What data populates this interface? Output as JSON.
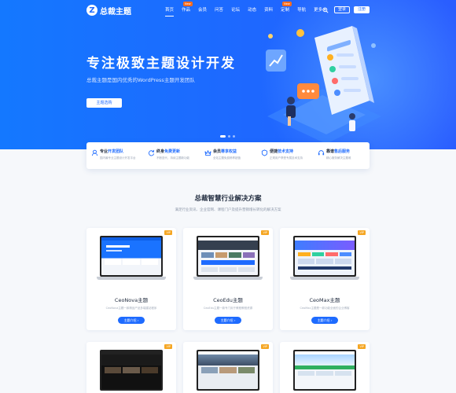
{
  "nav": {
    "logo_text": "总裁主题",
    "logo_mark": "Z",
    "menu": [
      {
        "label": "首页",
        "badge": "",
        "active": true
      },
      {
        "label": "作品",
        "badge": "New",
        "active": false
      },
      {
        "label": "会员",
        "badge": "",
        "active": false
      },
      {
        "label": "问答",
        "badge": "",
        "active": false
      },
      {
        "label": "论坛",
        "badge": "",
        "active": false
      },
      {
        "label": "动态",
        "badge": "",
        "active": false
      },
      {
        "label": "资料",
        "badge": "",
        "active": false
      },
      {
        "label": "定制",
        "badge": "New",
        "active": false
      },
      {
        "label": "导航",
        "badge": "",
        "active": false
      },
      {
        "label": "更多 ▾",
        "badge": "",
        "active": false
      }
    ],
    "login_label": "登录",
    "register_label": "注册"
  },
  "hero": {
    "title": "专注极致主题设计开发",
    "subtitle": "总裁主题是国内优秀的WordPress主题开发团队",
    "button_label": "主题选购"
  },
  "features": [
    {
      "title_a": "专业",
      "title_b": "开发团队",
      "desc": "国内最专业主题设计开发平台",
      "icon": "team-icon"
    },
    {
      "title_a": "终身",
      "title_b": "免费更新",
      "desc": "不断迭代，持续主题新功能",
      "icon": "update-icon"
    },
    {
      "title_a": "会员",
      "title_b": "尊享权益",
      "desc": "全站主题免费畅享超值",
      "icon": "vip-icon"
    },
    {
      "title_a": "便捷",
      "title_b": "技术支持",
      "desc": "正规用户享受专属技术支持",
      "icon": "support-icon"
    },
    {
      "title_a": "靠谱",
      "title_b": "售后服务",
      "desc": "精心服务解决主题难",
      "icon": "service-icon"
    }
  ],
  "solutions": {
    "title": "总裁智慧行业解决方案",
    "subtitle": "满足行业资讯、企业官网、课程门户及提升营销增长转化的解决方案"
  },
  "cards": [
    {
      "name": "CeoNova主题",
      "desc": "CeoNova主题一款精品产品多端建站程序",
      "tag": "VIP",
      "button": "主题介绍 ›"
    },
    {
      "name": "CeoEdu主题",
      "desc": "CeoEdu主题一款专门用于教程教程资源",
      "tag": "VIP",
      "button": "主题介绍 ›"
    },
    {
      "name": "CeoMax主题",
      "desc": "CeoMax主题是一款功能全面的企业博客",
      "tag": "VIP",
      "button": "主题介绍 ›"
    },
    {
      "name": "",
      "desc": "",
      "tag": "VIP",
      "button": ""
    },
    {
      "name": "",
      "desc": "",
      "tag": "VIP",
      "button": ""
    },
    {
      "name": "",
      "desc": "",
      "tag": "VIP",
      "button": ""
    }
  ],
  "colors": {
    "brand": "#1e6bff",
    "badge": "#ff6a1a",
    "vip": "#f5a623"
  }
}
